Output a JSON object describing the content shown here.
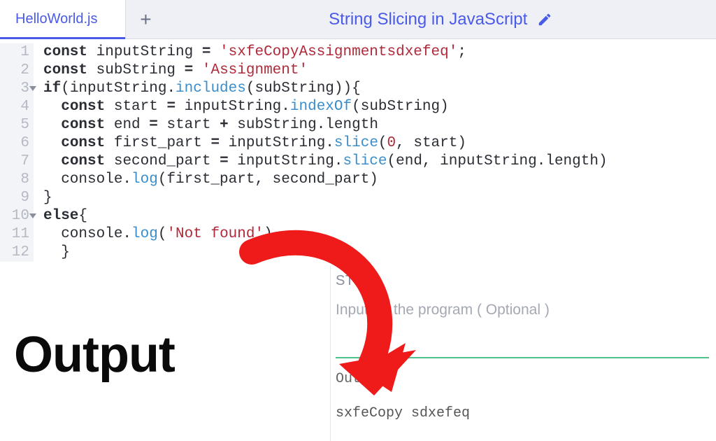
{
  "tabbar": {
    "tab_label": "HelloWorld.js",
    "title": "String Slicing in JavaScript"
  },
  "code": {
    "lines": [
      {
        "n": 1,
        "fold": false,
        "tokens": [
          [
            "kw",
            "const"
          ],
          [
            "",
            " inputString "
          ],
          [
            "kw",
            "="
          ],
          [
            "",
            " "
          ],
          [
            "str",
            "'sxfeCopyAssignmentsdxefeq'"
          ],
          [
            "",
            ";"
          ]
        ]
      },
      {
        "n": 2,
        "fold": false,
        "tokens": [
          [
            "kw",
            "const"
          ],
          [
            "",
            " subString "
          ],
          [
            "kw",
            "="
          ],
          [
            "",
            " "
          ],
          [
            "str",
            "'Assignment'"
          ]
        ]
      },
      {
        "n": 3,
        "fold": true,
        "tokens": [
          [
            "kw",
            "if"
          ],
          [
            "",
            "(inputString."
          ],
          [
            "fn",
            "includes"
          ],
          [
            "",
            "(subString)){"
          ]
        ]
      },
      {
        "n": 4,
        "fold": false,
        "tokens": [
          [
            "",
            "  "
          ],
          [
            "kw",
            "const"
          ],
          [
            "",
            " start "
          ],
          [
            "kw",
            "="
          ],
          [
            "",
            " inputString."
          ],
          [
            "fn",
            "indexOf"
          ],
          [
            "",
            "(subString)"
          ]
        ]
      },
      {
        "n": 5,
        "fold": false,
        "tokens": [
          [
            "",
            "  "
          ],
          [
            "kw",
            "const"
          ],
          [
            "",
            " end "
          ],
          [
            "kw",
            "="
          ],
          [
            "",
            " start "
          ],
          [
            "kw",
            "+"
          ],
          [
            "",
            " subString.length"
          ]
        ]
      },
      {
        "n": 6,
        "fold": false,
        "tokens": [
          [
            "",
            "  "
          ],
          [
            "kw",
            "const"
          ],
          [
            "",
            " first_part "
          ],
          [
            "kw",
            "="
          ],
          [
            "",
            " inputString."
          ],
          [
            "fn",
            "slice"
          ],
          [
            "",
            "("
          ],
          [
            "num",
            "0"
          ],
          [
            "",
            ", start)"
          ]
        ]
      },
      {
        "n": 7,
        "fold": false,
        "tokens": [
          [
            "",
            "  "
          ],
          [
            "kw",
            "const"
          ],
          [
            "",
            " second_part "
          ],
          [
            "kw",
            "="
          ],
          [
            "",
            " inputString."
          ],
          [
            "fn",
            "slice"
          ],
          [
            "",
            "(end, inputString.length)"
          ]
        ]
      },
      {
        "n": 8,
        "fold": false,
        "tokens": [
          [
            "",
            "  console."
          ],
          [
            "fn",
            "log"
          ],
          [
            "",
            "(first_part, second_part)"
          ]
        ]
      },
      {
        "n": 9,
        "fold": false,
        "tokens": [
          [
            "",
            "}"
          ]
        ]
      },
      {
        "n": 10,
        "fold": true,
        "tokens": [
          [
            "kw",
            "else"
          ],
          [
            "",
            "{"
          ]
        ]
      },
      {
        "n": 11,
        "fold": false,
        "tokens": [
          [
            "",
            "  console."
          ],
          [
            "fn",
            "log"
          ],
          [
            "",
            "("
          ],
          [
            "str",
            "'Not found'"
          ],
          [
            "",
            ")"
          ]
        ]
      },
      {
        "n": 12,
        "fold": false,
        "tokens": [
          [
            "",
            "  }"
          ]
        ]
      }
    ]
  },
  "stdin": {
    "label": "STDIN",
    "placeholder": "Input for the program ( Optional )"
  },
  "output": {
    "label": "Output:",
    "text": "sxfeCopy sdxefeq"
  },
  "annotation": {
    "big_label": "Output"
  }
}
